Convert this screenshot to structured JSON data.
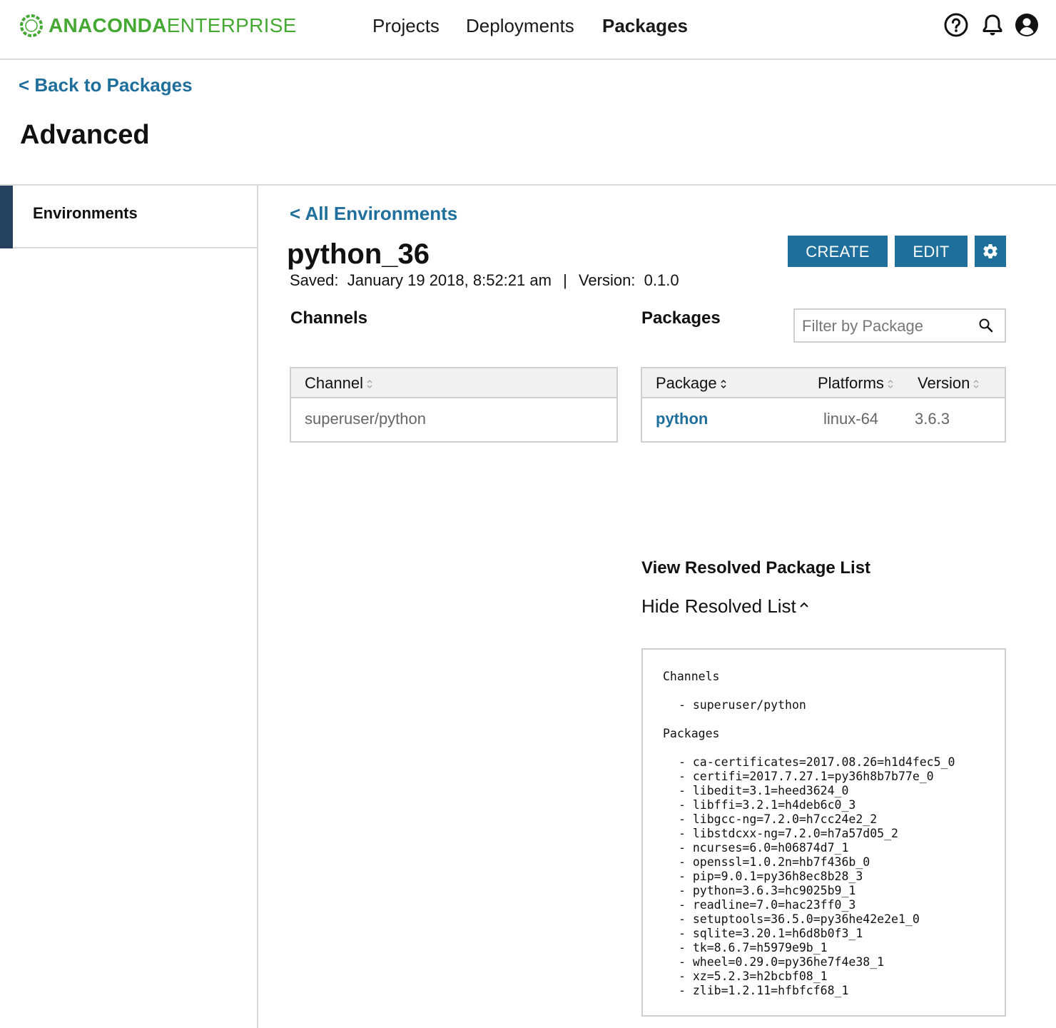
{
  "brand": {
    "bold": "ANACONDA",
    "light": "ENTERPRISE",
    "color": "#44a833"
  },
  "nav": {
    "projects": "Projects",
    "deployments": "Deployments",
    "packages": "Packages"
  },
  "header_icons": [
    "help-icon",
    "bell-icon",
    "user-icon"
  ],
  "back_link": "< Back to Packages",
  "page_title": "Advanced",
  "sidebar": {
    "items": [
      {
        "label": "Environments",
        "active": true
      }
    ]
  },
  "environment": {
    "back_link": "< All Environments",
    "name": "python_36",
    "saved_label": "Saved:",
    "saved_value": "January 19 2018, 8:52:21 am",
    "separator": "|",
    "version_label": "Version:",
    "version_value": "0.1.0"
  },
  "buttons": {
    "create": "CREATE",
    "edit": "EDIT",
    "settings_icon": "gear-icon"
  },
  "channels": {
    "heading": "Channels",
    "column": "Channel",
    "rows": [
      "superuser/python"
    ]
  },
  "packages": {
    "heading": "Packages",
    "filter_placeholder": "Filter by Package",
    "columns": {
      "package": "Package",
      "platforms": "Platforms",
      "version": "Version"
    },
    "rows": [
      {
        "package": "python",
        "platforms": "linux-64",
        "version": "3.6.3"
      }
    ]
  },
  "resolved": {
    "heading": "View Resolved Package List",
    "toggle": "Hide Resolved List",
    "channels_label": "Channels",
    "channels": [
      "- superuser/python"
    ],
    "packages_label": "Packages",
    "packages": [
      "- ca-certificates=2017.08.26=h1d4fec5_0",
      "- certifi=2017.7.27.1=py36h8b7b77e_0",
      "- libedit=3.1=heed3624_0",
      "- libffi=3.2.1=h4deb6c0_3",
      "- libgcc-ng=7.2.0=h7cc24e2_2",
      "- libstdcxx-ng=7.2.0=h7a57d05_2",
      "- ncurses=6.0=h06874d7_1",
      "- openssl=1.0.2n=hb7f436b_0",
      "- pip=9.0.1=py36h8ec8b28_3",
      "- python=3.6.3=hc9025b9_1",
      "- readline=7.0=hac23ff0_3",
      "- setuptools=36.5.0=py36he42e2e1_0",
      "- sqlite=3.20.1=h6d8b0f3_1",
      "- tk=8.6.7=h5979e9b_1",
      "- wheel=0.29.0=py36he7f4e38_1",
      "- xz=5.2.3=h2bcbf08_1",
      "- zlib=1.2.11=hfbfcf68_1"
    ]
  },
  "colors": {
    "link": "#1f6f9c",
    "button": "#1f6f9c",
    "sidebar_accent": "#24425e",
    "border": "#d9d9d9"
  }
}
